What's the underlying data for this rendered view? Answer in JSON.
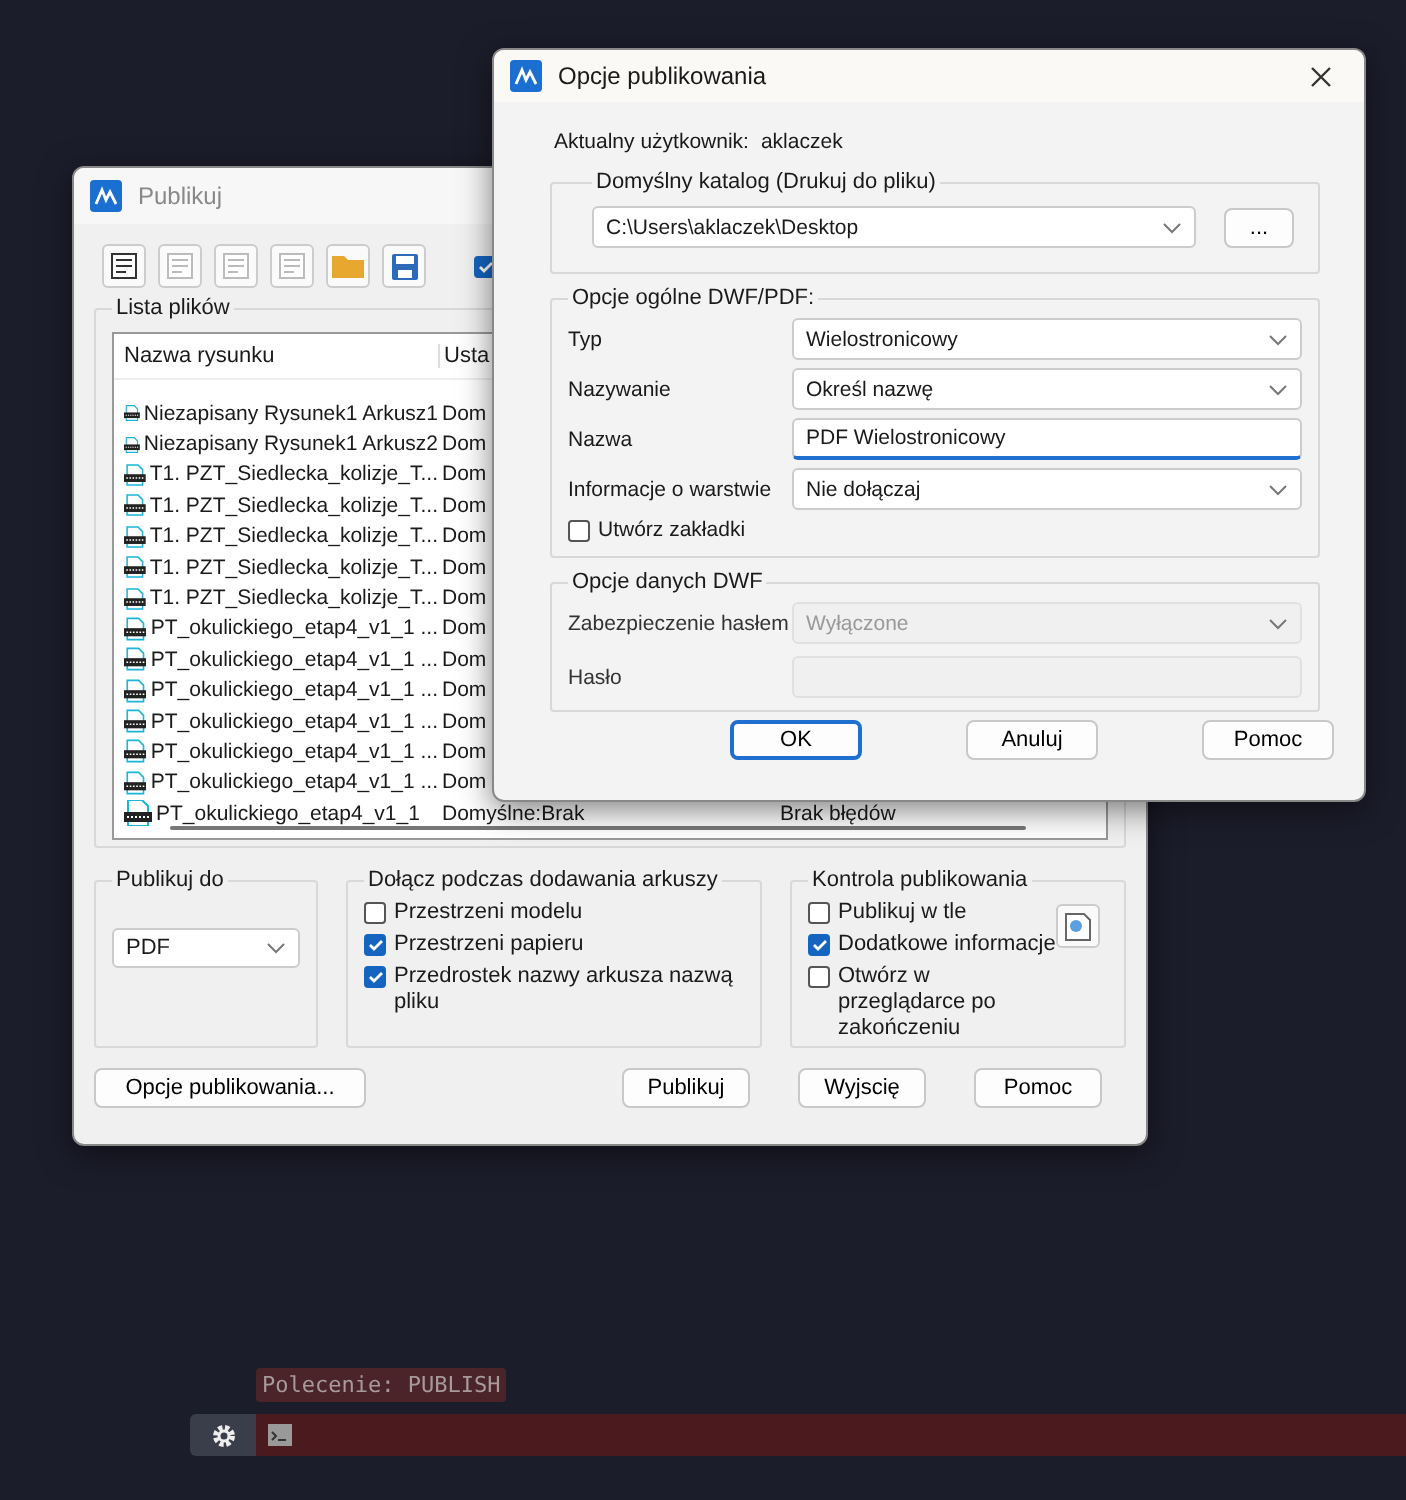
{
  "publish_window": {
    "title": "Publikuj",
    "toolbar_checkbox": {
      "checked": true
    },
    "file_list": {
      "title": "Lista plików",
      "columns": [
        "Nazwa rysunku",
        "Usta"
      ],
      "rows": [
        {
          "name": "Niezapisany Rysunek1 Arkusz1",
          "setting": "Dom"
        },
        {
          "name": "Niezapisany Rysunek1 Arkusz2",
          "setting": "Dom"
        },
        {
          "name": "T1. PZT_Siedlecka_kolizje_T...",
          "setting": "Dom"
        },
        {
          "name": "T1. PZT_Siedlecka_kolizje_T...",
          "setting": "Dom"
        },
        {
          "name": "T1. PZT_Siedlecka_kolizje_T...",
          "setting": "Dom"
        },
        {
          "name": "T1. PZT_Siedlecka_kolizje_T...",
          "setting": "Dom"
        },
        {
          "name": "T1. PZT_Siedlecka_kolizje_T...",
          "setting": "Dom"
        },
        {
          "name": "PT_okulickiego_etap4_v1_1 ...",
          "setting": "Dom"
        },
        {
          "name": "PT_okulickiego_etap4_v1_1 ...",
          "setting": "Dom"
        },
        {
          "name": "PT_okulickiego_etap4_v1_1 ...",
          "setting": "Dom"
        },
        {
          "name": "PT_okulickiego_etap4_v1_1 ...",
          "setting": "Dom"
        },
        {
          "name": "PT_okulickiego_etap4_v1_1 ...",
          "setting": "Dom"
        },
        {
          "name": "PT_okulickiego_etap4_v1_1 ...",
          "setting": "Dom"
        },
        {
          "name": "PT_okulickiego_etap4_v1_1",
          "setting": "Domyślne:Brak",
          "status": "Brak błędów"
        }
      ]
    },
    "publish_to": {
      "title": "Publikuj do",
      "value": "PDF"
    },
    "include_group": {
      "title": "Dołącz podczas dodawania arkuszy",
      "options": [
        {
          "label": "Przestrzeni modelu",
          "checked": false
        },
        {
          "label": "Przestrzeni papieru",
          "checked": true
        },
        {
          "label": "Przedrostek nazwy arkusza nazwą pliku",
          "checked": true
        }
      ]
    },
    "control_group": {
      "title": "Kontrola publikowania",
      "options": [
        {
          "label": "Publikuj w tle",
          "checked": false
        },
        {
          "label": "Dodatkowe informacje",
          "checked": true
        },
        {
          "label": "Otwórz w przeglądarce po zakończeniu",
          "checked": false
        }
      ]
    },
    "buttons": [
      "Opcje publikowania...",
      "Publikuj",
      "Wyjscię",
      "Pomoc"
    ]
  },
  "options_dialog": {
    "title": "Opcje publikowania",
    "user_label": "Aktualny użytkownik:",
    "user": "aklaczek",
    "catalog_group": {
      "title": "Domyślny katalog (Drukuj do pliku)",
      "path": "C:\\Users\\aklaczek\\Desktop",
      "browse": "..."
    },
    "general_group": {
      "title": "Opcje ogólne DWF/PDF:",
      "fields": [
        {
          "label": "Typ",
          "kind": "select",
          "value": "Wielostronicowy",
          "focused": false
        },
        {
          "label": "Nazywanie",
          "kind": "select",
          "value": "Określ nazwę",
          "focused": false
        },
        {
          "label": "Nazwa",
          "kind": "text",
          "value": "PDF Wielostronicowy",
          "focused": true
        },
        {
          "label": "Informacje o warstwie",
          "kind": "select",
          "value": "Nie dołączaj",
          "focused": false
        }
      ],
      "bookmarks": {
        "label": "Utwórz zakładki",
        "checked": false
      }
    },
    "dwf_group": {
      "title": "Opcje danych DWF",
      "fields": [
        {
          "label": "Zabezpieczenie hasłem",
          "kind": "select",
          "value": "Wyłączone",
          "disabled": true
        },
        {
          "label": "Hasło",
          "kind": "text",
          "disabled": true
        }
      ]
    },
    "buttons": [
      {
        "label": "OK",
        "default": true
      },
      {
        "label": "Anuluj",
        "default": false
      },
      {
        "label": "Pomoc",
        "default": false
      }
    ]
  },
  "command_line": {
    "text": "Polecenie: PUBLISH"
  }
}
